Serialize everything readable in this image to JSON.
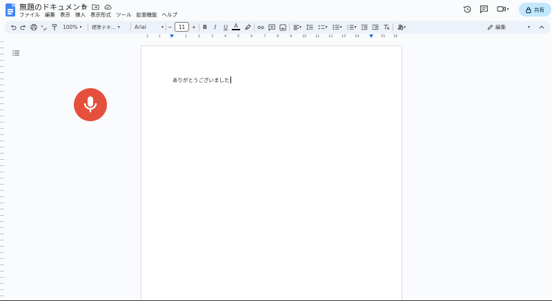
{
  "title_bar": {
    "doc_title": "無題のドキュメント",
    "icons": [
      "star-icon",
      "folder-move-icon",
      "cloud-status-icon"
    ]
  },
  "menu": {
    "items": [
      "ファイル",
      "編集",
      "表示",
      "挿入",
      "表示形式",
      "ツール",
      "拡張機能",
      "ヘルプ"
    ]
  },
  "header_right": {
    "icons": [
      "history-icon",
      "comment-icon",
      "meet-video-icon"
    ],
    "share_label": "共有"
  },
  "toolbar": {
    "zoom": "100%",
    "style": "標準テキ...",
    "font": "Arial",
    "font_size": "11",
    "minus": "−",
    "plus": "+",
    "bold": "B",
    "italic": "I",
    "underline": "U",
    "text_color": "A",
    "input_tool": "あ",
    "mode": "編集"
  },
  "ruler": {
    "ticks": [
      "2",
      "1",
      "1",
      "2",
      "3",
      "4",
      "5",
      "6",
      "7",
      "8",
      "9",
      "10",
      "11",
      "12",
      "13",
      "14",
      "15",
      "16",
      "17",
      "18"
    ]
  },
  "document": {
    "body_text": "ありがとうございました"
  },
  "colors": {
    "accent": "#1a73e8",
    "share_bg": "#c2e7ff",
    "mic": "#e5503c",
    "toolbar_bg": "#edf2fa"
  }
}
